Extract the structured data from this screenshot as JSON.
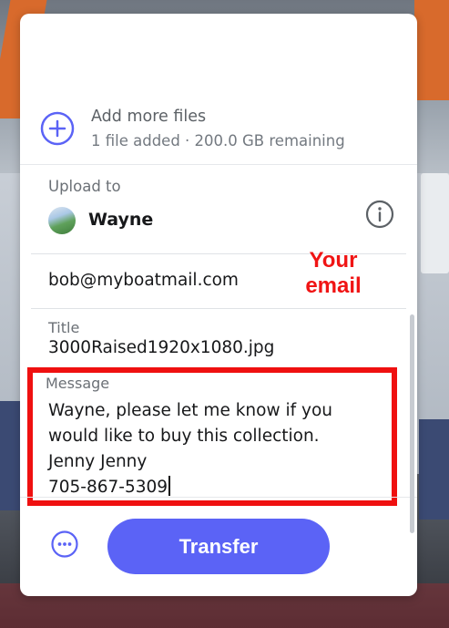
{
  "add_files": {
    "title": "Add more files",
    "subtitle": "1 file added · 200.0 GB remaining"
  },
  "upload_to": {
    "label": "Upload to",
    "name": "Wayne"
  },
  "email": {
    "value": "bob@myboatmail.com",
    "annotation": "Your email"
  },
  "title_field": {
    "label": "Title",
    "value": "3000Raised1920x1080.jpg"
  },
  "message": {
    "label": "Message",
    "value": "Wayne, please let me know if you\nwould like to buy this collection.\nJenny Jenny\n705-867-5309"
  },
  "actions": {
    "transfer_label": "Transfer"
  },
  "icons": {
    "add": "plus-circle-icon",
    "info": "info-icon",
    "more": "more-options-icon"
  },
  "colors": {
    "accent": "#5b63f6",
    "annotation": "#f01414"
  }
}
